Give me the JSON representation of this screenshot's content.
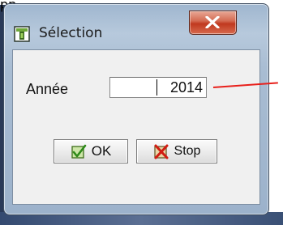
{
  "desktop": {
    "top_glyph": "pp"
  },
  "window": {
    "title": "Sélection",
    "close_glyph": "X"
  },
  "form": {
    "year_label": "Année",
    "year_value": "2014"
  },
  "buttons": {
    "ok_label": "OK",
    "stop_label": "Stop"
  },
  "colors": {
    "annotation_line": "#e8201b",
    "close_button": "#c0391f",
    "frame": "#a9bdd3"
  }
}
